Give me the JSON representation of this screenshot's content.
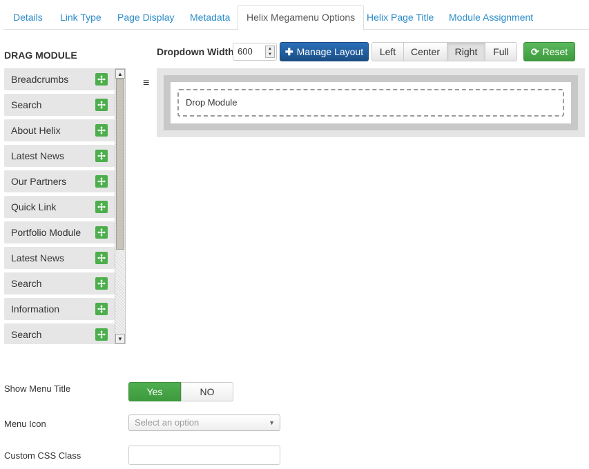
{
  "tabs": [
    {
      "label": "Details"
    },
    {
      "label": "Link Type"
    },
    {
      "label": "Page Display"
    },
    {
      "label": "Metadata"
    },
    {
      "label": "Helix Megamenu Options"
    },
    {
      "label": "Helix Page Title"
    },
    {
      "label": "Module Assignment"
    }
  ],
  "active_tab": "Helix Megamenu Options",
  "drag_module": {
    "title": "DRAG MODULE",
    "items": [
      {
        "label": "Breadcrumbs"
      },
      {
        "label": "Search"
      },
      {
        "label": "About Helix"
      },
      {
        "label": "Latest News"
      },
      {
        "label": "Our Partners"
      },
      {
        "label": "Quick Link"
      },
      {
        "label": "Portfolio Module"
      },
      {
        "label": "Latest News"
      },
      {
        "label": "Search"
      },
      {
        "label": "Information"
      },
      {
        "label": "Search"
      }
    ]
  },
  "toolbar": {
    "dropdown_width_label": "Dropdown Width",
    "dropdown_width_value": "600",
    "manage_layout_label": "Manage Layout",
    "alignment": [
      {
        "label": "Left"
      },
      {
        "label": "Center"
      },
      {
        "label": "Right"
      },
      {
        "label": "Full"
      }
    ],
    "selected_alignment": "Right",
    "reset_label": "Reset"
  },
  "layout": {
    "drop_label": "Drop Module"
  },
  "form": {
    "show_menu_title": {
      "label": "Show Menu Title",
      "yes": "Yes",
      "no": "NO",
      "value": "Yes"
    },
    "menu_icon": {
      "label": "Menu Icon",
      "placeholder": "Select an option"
    },
    "custom_css": {
      "label": "Custom CSS Class",
      "value": ""
    }
  },
  "colors": {
    "link": "#2a8bc9",
    "primary": "#1f5c9e",
    "success": "#4cae4c",
    "drag_item_bg": "#e6e6e6"
  },
  "icons": {
    "move": "move-icon",
    "plus": "plus-icon",
    "refresh": "refresh-icon",
    "hamburger": "hamburger-icon",
    "dropdown": "chevron-down-icon"
  }
}
